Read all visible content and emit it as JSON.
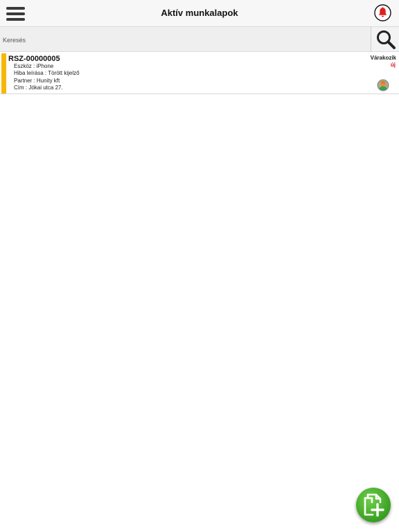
{
  "header": {
    "title": "Aktív munkalapok",
    "menu_icon": "hamburger-menu-icon",
    "notification_icon": "bell-icon",
    "notification_color": "#e02020"
  },
  "search": {
    "placeholder": "Keresés",
    "value": "",
    "button_icon": "magnifier-icon"
  },
  "worksheets": [
    {
      "id": "RSZ-00000005",
      "device_label": "Eszköz : iPhone",
      "fault_label": "Hiba leírása : Törött kijelző",
      "partner_label": "Partner : Hunity kft",
      "address_label": "Cím : Jókai utca 27.",
      "status": "Várakozik",
      "badge": "új",
      "accent_color": "#f5b800",
      "badge_color": "#d01818",
      "assignee_icon": "user-avatar-icon"
    }
  ],
  "fab": {
    "icon": "add-worksheet-icon",
    "color": "#3a9e22"
  }
}
